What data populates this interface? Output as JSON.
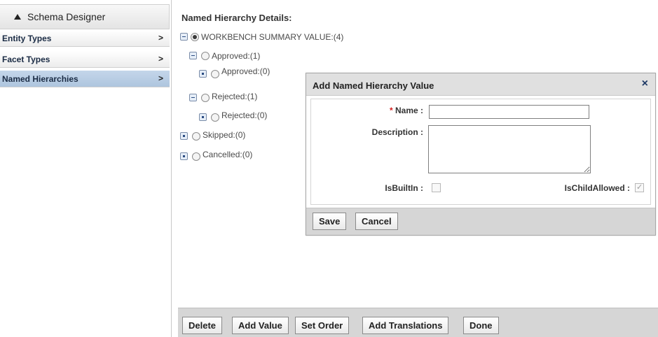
{
  "sidebar": {
    "title": "Schema Designer",
    "items": [
      {
        "label": "Entity Types",
        "chevron": ">"
      },
      {
        "label": "Facet Types",
        "chevron": ">"
      },
      {
        "label": "Named Hierarchies",
        "chevron": ">",
        "selected": true
      }
    ]
  },
  "main": {
    "title": "Named Hierarchy Details:",
    "tree": [
      {
        "label": "WORKBENCH SUMMARY VALUE:(4)",
        "toggle": "minus",
        "radio_selected": true
      },
      {
        "label": "Approved:(1)",
        "toggle": "minus"
      },
      {
        "label": "Approved:(0)",
        "toggle": "leaf"
      },
      {
        "label": "Rejected:(1)",
        "toggle": "minus"
      },
      {
        "label": "Rejected:(0)",
        "toggle": "leaf"
      },
      {
        "label": "Skipped:(0)",
        "toggle": "leaf"
      },
      {
        "label": "Cancelled:(0)",
        "toggle": "leaf"
      }
    ],
    "toolbar": {
      "delete": "Delete",
      "add_value": "Add Value",
      "set_order": "Set Order",
      "add_translations": "Add Translations",
      "done": "Done"
    }
  },
  "dialog": {
    "title": "Add Named Hierarchy Value",
    "close": "×",
    "name_label": "Name :",
    "required_marker": "*",
    "name_value": "",
    "description_label": "Description :",
    "description_value": "",
    "isbuiltin_label": "IsBuiltIn :",
    "isbuiltin_checked": false,
    "ischildallowed_label": "IsChildAllowed :",
    "ischildallowed_checked": true,
    "save": "Save",
    "cancel": "Cancel"
  }
}
